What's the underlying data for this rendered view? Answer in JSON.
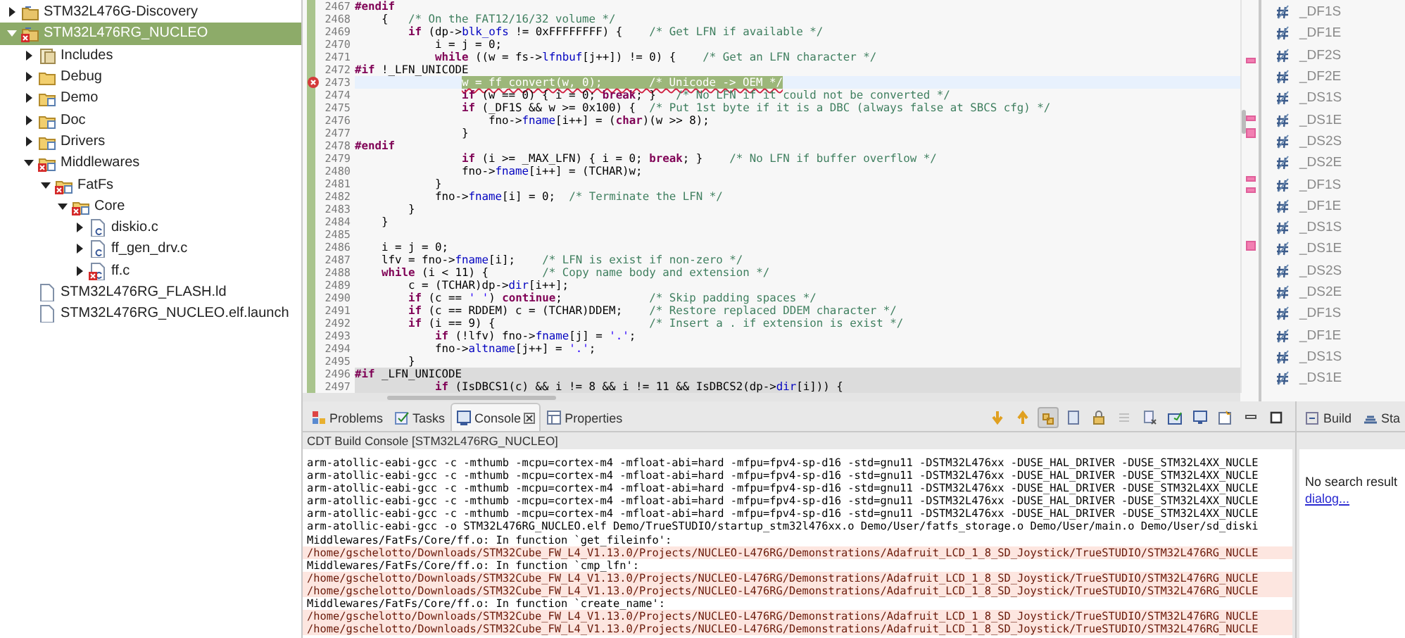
{
  "project_explorer": {
    "items": [
      {
        "label": "STM32L476G-Discovery",
        "kind": "project",
        "error": false,
        "selected": false,
        "expanded": false
      },
      {
        "label": "STM32L476RG_NUCLEO",
        "kind": "project",
        "error": true,
        "selected": true,
        "expanded": true,
        "children": [
          {
            "label": "Includes",
            "kind": "includes",
            "error": false,
            "selected": false,
            "expanded": false
          },
          {
            "label": "Debug",
            "kind": "folder",
            "error": false,
            "selected": false,
            "expanded": false
          },
          {
            "label": "Demo",
            "kind": "source",
            "error": false,
            "selected": false,
            "expanded": false
          },
          {
            "label": "Doc",
            "kind": "source",
            "error": false,
            "selected": false,
            "expanded": false
          },
          {
            "label": "Drivers",
            "kind": "source",
            "error": false,
            "selected": false,
            "expanded": false
          },
          {
            "label": "Middlewares",
            "kind": "source",
            "error": true,
            "selected": false,
            "expanded": true,
            "children": [
              {
                "label": "FatFs",
                "kind": "source",
                "error": true,
                "selected": false,
                "expanded": true,
                "children": [
                  {
                    "label": "Core",
                    "kind": "source",
                    "error": true,
                    "selected": false,
                    "expanded": true,
                    "children": [
                      {
                        "label": "diskio.c",
                        "kind": "csource",
                        "error": false,
                        "selected": false,
                        "expanded": false
                      },
                      {
                        "label": "ff_gen_drv.c",
                        "kind": "csource",
                        "error": false,
                        "selected": false,
                        "expanded": false
                      },
                      {
                        "label": "ff.c",
                        "kind": "csource",
                        "error": true,
                        "selected": false,
                        "expanded": false
                      }
                    ]
                  }
                ]
              }
            ]
          },
          {
            "label": "STM32L476RG_FLASH.ld",
            "kind": "file",
            "error": false,
            "selected": false
          },
          {
            "label": "STM32L476RG_NUCLEO.elf.launch",
            "kind": "file",
            "error": false,
            "selected": false
          }
        ]
      }
    ]
  },
  "editor": {
    "lines": [
      {
        "number": "2467",
        "current": false,
        "shaded": false,
        "error": false,
        "tokens": [
          {
            "kind": "pp",
            "text": "#endif"
          }
        ]
      },
      {
        "number": "2468",
        "current": false,
        "shaded": false,
        "error": false,
        "tokens": [
          {
            "kind": "code",
            "text": "    {   "
          },
          {
            "kind": "comment",
            "text": "/* On the FAT12/16/32 volume */"
          }
        ]
      },
      {
        "number": "2469",
        "current": false,
        "shaded": false,
        "error": false,
        "tokens": [
          {
            "kind": "kw",
            "text": "        if"
          },
          {
            "kind": "code",
            "text": " (dp->"
          },
          {
            "kind": "field",
            "text": "blk_ofs"
          },
          {
            "kind": "code",
            "text": " != 0xFFFFFFFF) {    "
          },
          {
            "kind": "comment",
            "text": "/* Get LFN if available */"
          }
        ]
      },
      {
        "number": "2470",
        "current": false,
        "shaded": false,
        "error": false,
        "tokens": [
          {
            "kind": "code",
            "text": "            i = j = 0;"
          }
        ]
      },
      {
        "number": "2471",
        "current": false,
        "shaded": false,
        "error": false,
        "tokens": [
          {
            "kind": "kw",
            "text": "            while"
          },
          {
            "kind": "code",
            "text": " ((w = fs->"
          },
          {
            "kind": "field",
            "text": "lfnbuf"
          },
          {
            "kind": "code",
            "text": "[j++]) != 0) {    "
          },
          {
            "kind": "comment",
            "text": "/* Get an LFN character */"
          }
        ]
      },
      {
        "number": "2472",
        "current": false,
        "shaded": false,
        "error": false,
        "tokens": [
          {
            "kind": "pp",
            "text": "#if"
          },
          {
            "kind": "code",
            "text": " !_LFN_UNICODE"
          }
        ]
      },
      {
        "number": "2473",
        "current": true,
        "shaded": false,
        "error": true,
        "tokens": [
          {
            "kind": "selection",
            "text": "                w = ff_convert(w, 0);       /* Unicode -> OEM */"
          }
        ]
      },
      {
        "number": "2474",
        "current": false,
        "shaded": false,
        "error": false,
        "tokens": [
          {
            "kind": "kw",
            "text": "                if"
          },
          {
            "kind": "code",
            "text": " (w == 0) { i = 0; "
          },
          {
            "kind": "kw",
            "text": "break"
          },
          {
            "kind": "code",
            "text": "; }   "
          },
          {
            "kind": "comment",
            "text": "/* No LFN if it could not be converted */"
          }
        ]
      },
      {
        "number": "2475",
        "current": false,
        "shaded": false,
        "error": false,
        "tokens": [
          {
            "kind": "kw",
            "text": "                if"
          },
          {
            "kind": "code",
            "text": " (_DF1S && w >= 0x100) {  "
          },
          {
            "kind": "comment",
            "text": "/* Put 1st byte if it is a DBC (always false at SBCS cfg) */"
          }
        ]
      },
      {
        "number": "2476",
        "current": false,
        "shaded": false,
        "error": false,
        "tokens": [
          {
            "kind": "code",
            "text": "                    fno->"
          },
          {
            "kind": "field",
            "text": "fname"
          },
          {
            "kind": "code",
            "text": "[i++] = ("
          },
          {
            "kind": "kw",
            "text": "char"
          },
          {
            "kind": "code",
            "text": ")(w >> 8);"
          }
        ]
      },
      {
        "number": "2477",
        "current": false,
        "shaded": false,
        "error": false,
        "tokens": [
          {
            "kind": "code",
            "text": "                }"
          }
        ]
      },
      {
        "number": "2478",
        "current": false,
        "shaded": false,
        "error": false,
        "tokens": [
          {
            "kind": "pp",
            "text": "#endif"
          }
        ]
      },
      {
        "number": "2479",
        "current": false,
        "shaded": false,
        "error": false,
        "tokens": [
          {
            "kind": "kw",
            "text": "                if"
          },
          {
            "kind": "code",
            "text": " (i >= _MAX_LFN) { i = 0; "
          },
          {
            "kind": "kw",
            "text": "break"
          },
          {
            "kind": "code",
            "text": "; }    "
          },
          {
            "kind": "comment",
            "text": "/* No LFN if buffer overflow */"
          }
        ]
      },
      {
        "number": "2480",
        "current": false,
        "shaded": false,
        "error": false,
        "tokens": [
          {
            "kind": "code",
            "text": "                fno->"
          },
          {
            "kind": "field",
            "text": "fname"
          },
          {
            "kind": "code",
            "text": "[i++] = (TCHAR)w;"
          }
        ]
      },
      {
        "number": "2481",
        "current": false,
        "shaded": false,
        "error": false,
        "tokens": [
          {
            "kind": "code",
            "text": "            }"
          }
        ]
      },
      {
        "number": "2482",
        "current": false,
        "shaded": false,
        "error": false,
        "tokens": [
          {
            "kind": "code",
            "text": "            fno->"
          },
          {
            "kind": "field",
            "text": "fname"
          },
          {
            "kind": "code",
            "text": "[i] = 0;  "
          },
          {
            "kind": "comment",
            "text": "/* Terminate the LFN */"
          }
        ]
      },
      {
        "number": "2483",
        "current": false,
        "shaded": false,
        "error": false,
        "tokens": [
          {
            "kind": "code",
            "text": "        }"
          }
        ]
      },
      {
        "number": "2484",
        "current": false,
        "shaded": false,
        "error": false,
        "tokens": [
          {
            "kind": "code",
            "text": "    }"
          }
        ]
      },
      {
        "number": "2485",
        "current": false,
        "shaded": false,
        "error": false
      },
      {
        "number": "2486",
        "current": false,
        "shaded": false,
        "error": false,
        "tokens": [
          {
            "kind": "code",
            "text": "    i = j = 0;"
          }
        ]
      },
      {
        "number": "2487",
        "current": false,
        "shaded": false,
        "error": false,
        "tokens": [
          {
            "kind": "code",
            "text": "    lfv = fno->"
          },
          {
            "kind": "field",
            "text": "fname"
          },
          {
            "kind": "code",
            "text": "[i];    "
          },
          {
            "kind": "comment",
            "text": "/* LFN is exist if non-zero */"
          }
        ]
      },
      {
        "number": "2488",
        "current": false,
        "shaded": false,
        "error": false,
        "tokens": [
          {
            "kind": "kw",
            "text": "    while"
          },
          {
            "kind": "code",
            "text": " (i < 11) {        "
          },
          {
            "kind": "comment",
            "text": "/* Copy name body and extension */"
          }
        ]
      },
      {
        "number": "2489",
        "current": false,
        "shaded": false,
        "error": false,
        "tokens": [
          {
            "kind": "code",
            "text": "        c = (TCHAR)dp->"
          },
          {
            "kind": "field",
            "text": "dir"
          },
          {
            "kind": "code",
            "text": "[i++];"
          }
        ]
      },
      {
        "number": "2490",
        "current": false,
        "shaded": false,
        "error": false,
        "tokens": [
          {
            "kind": "kw",
            "text": "        if"
          },
          {
            "kind": "code",
            "text": " (c == "
          },
          {
            "kind": "string",
            "text": "' '"
          },
          {
            "kind": "code",
            "text": ") "
          },
          {
            "kind": "kw",
            "text": "continue"
          },
          {
            "kind": "code",
            "text": ";             "
          },
          {
            "kind": "comment",
            "text": "/* Skip padding spaces */"
          }
        ]
      },
      {
        "number": "2491",
        "current": false,
        "shaded": false,
        "error": false,
        "tokens": [
          {
            "kind": "kw",
            "text": "        if"
          },
          {
            "kind": "code",
            "text": " (c == RDDEM) c = (TCHAR)DDEM;    "
          },
          {
            "kind": "comment",
            "text": "/* Restore replaced DDEM character */"
          }
        ]
      },
      {
        "number": "2492",
        "current": false,
        "shaded": false,
        "error": false,
        "tokens": [
          {
            "kind": "kw",
            "text": "        if"
          },
          {
            "kind": "code",
            "text": " (i == 9) {                       "
          },
          {
            "kind": "comment",
            "text": "/* Insert a . if extension is exist */"
          }
        ]
      },
      {
        "number": "2493",
        "current": false,
        "shaded": false,
        "error": false,
        "tokens": [
          {
            "kind": "kw",
            "text": "            if"
          },
          {
            "kind": "code",
            "text": " (!lfv) fno->"
          },
          {
            "kind": "field",
            "text": "fname"
          },
          {
            "kind": "code",
            "text": "[j] = "
          },
          {
            "kind": "string",
            "text": "'.'"
          },
          {
            "kind": "code",
            "text": ";"
          }
        ]
      },
      {
        "number": "2494",
        "current": false,
        "shaded": false,
        "error": false,
        "tokens": [
          {
            "kind": "code",
            "text": "            fno->"
          },
          {
            "kind": "field",
            "text": "altname"
          },
          {
            "kind": "code",
            "text": "[j++] = "
          },
          {
            "kind": "string",
            "text": "'.'"
          },
          {
            "kind": "code",
            "text": ";"
          }
        ]
      },
      {
        "number": "2495",
        "current": false,
        "shaded": false,
        "error": false,
        "tokens": [
          {
            "kind": "code",
            "text": "        }"
          }
        ]
      },
      {
        "number": "2496",
        "current": false,
        "shaded": true,
        "error": false,
        "tokens": [
          {
            "kind": "pp",
            "text": "#if"
          },
          {
            "kind": "code",
            "text": " _LFN_UNICODE"
          }
        ]
      },
      {
        "number": "2497",
        "current": false,
        "shaded": true,
        "error": false,
        "tokens": [
          {
            "kind": "kw",
            "text": "            if"
          },
          {
            "kind": "code",
            "text": " (IsDBCS1(c) && i != 8 && i != 11 && IsDBCS2(dp->"
          },
          {
            "kind": "field",
            "text": "dir"
          },
          {
            "kind": "code",
            "text": "[i])) {"
          }
        ]
      }
    ]
  },
  "outline": {
    "items": [
      "_DF1S",
      "_DF1E",
      "_DF2S",
      "_DF2E",
      "_DS1S",
      "_DS1E",
      "_DS2S",
      "_DS2E",
      "_DF1S",
      "_DF1E",
      "_DS1S",
      "_DS1E",
      "_DS2S",
      "_DS2E",
      "_DF1S",
      "_DF1E",
      "_DS1S",
      "_DS1E"
    ]
  },
  "bottom_panel": {
    "tabs": [
      {
        "label": "Problems",
        "kind": "problems",
        "selected": false,
        "closable": false
      },
      {
        "label": "Tasks",
        "kind": "tasks",
        "selected": false,
        "closable": false
      },
      {
        "label": "Console",
        "kind": "console",
        "selected": true,
        "closable": true
      },
      {
        "label": "Properties",
        "kind": "properties",
        "selected": false,
        "closable": false
      }
    ],
    "console_title": "CDT Build Console [STM32L476RG_NUCLEO]",
    "console_lines": [
      {
        "kind": "output",
        "text": "arm-atollic-eabi-gcc -c -mthumb -mcpu=cortex-m4 -mfloat-abi=hard -mfpu=fpv4-sp-d16 -std=gnu11 -DSTM32L476xx -DUSE_HAL_DRIVER -DUSE_STM32L4XX_NUCLE"
      },
      {
        "kind": "output",
        "text": "arm-atollic-eabi-gcc -c -mthumb -mcpu=cortex-m4 -mfloat-abi=hard -mfpu=fpv4-sp-d16 -std=gnu11 -DSTM32L476xx -DUSE_HAL_DRIVER -DUSE_STM32L4XX_NUCLE"
      },
      {
        "kind": "output",
        "text": "arm-atollic-eabi-gcc -c -mthumb -mcpu=cortex-m4 -mfloat-abi=hard -mfpu=fpv4-sp-d16 -std=gnu11 -DSTM32L476xx -DUSE_HAL_DRIVER -DUSE_STM32L4XX_NUCLE"
      },
      {
        "kind": "output",
        "text": "arm-atollic-eabi-gcc -c -mthumb -mcpu=cortex-m4 -mfloat-abi=hard -mfpu=fpv4-sp-d16 -std=gnu11 -DSTM32L476xx -DUSE_HAL_DRIVER -DUSE_STM32L4XX_NUCLE"
      },
      {
        "kind": "output",
        "text": "arm-atollic-eabi-gcc -c -mthumb -mcpu=cortex-m4 -mfloat-abi=hard -mfpu=fpv4-sp-d16 -std=gnu11 -DSTM32L476xx -DUSE_HAL_DRIVER -DUSE_STM32L4XX_NUCLE"
      },
      {
        "kind": "output",
        "text": "arm-atollic-eabi-gcc -o STM32L476RG_NUCLEO.elf Demo/TrueSTUDIO/startup_stm32l476xx.o Demo/User/fatfs_storage.o Demo/User/main.o Demo/User/sd_diski"
      },
      {
        "kind": "output",
        "text": "Middlewares/FatFs/Core/ff.o: In function `get_fileinfo':"
      },
      {
        "kind": "error",
        "text": "/home/gschelotto/Downloads/STM32Cube_FW_L4_V1.13.0/Projects/NUCLEO-L476RG/Demonstrations/Adafruit_LCD_1_8_SD_Joystick/TrueSTUDIO/STM32L476RG_NUCLE"
      },
      {
        "kind": "output",
        "text": "Middlewares/FatFs/Core/ff.o: In function `cmp_lfn':"
      },
      {
        "kind": "error",
        "text": "/home/gschelotto/Downloads/STM32Cube_FW_L4_V1.13.0/Projects/NUCLEO-L476RG/Demonstrations/Adafruit_LCD_1_8_SD_Joystick/TrueSTUDIO/STM32L476RG_NUCLE"
      },
      {
        "kind": "error",
        "text": "/home/gschelotto/Downloads/STM32Cube_FW_L4_V1.13.0/Projects/NUCLEO-L476RG/Demonstrations/Adafruit_LCD_1_8_SD_Joystick/TrueSTUDIO/STM32L476RG_NUCLE"
      },
      {
        "kind": "output",
        "text": "Middlewares/FatFs/Core/ff.o: In function `create_name':"
      },
      {
        "kind": "error",
        "text": "/home/gschelotto/Downloads/STM32Cube_FW_L4_V1.13.0/Projects/NUCLEO-L476RG/Demonstrations/Adafruit_LCD_1_8_SD_Joystick/TrueSTUDIO/STM32L476RG_NUCLE"
      },
      {
        "kind": "error",
        "text": "/home/gschelotto/Downloads/STM32Cube_FW_L4_V1.13.0/Projects/NUCLEO-L476RG/Demonstrations/Adafruit_LCD_1_8_SD_Joystick/TrueSTUDIO/STM32L476RG_NUCLE"
      }
    ]
  },
  "search_panel": {
    "tabs": [
      {
        "label": "Build",
        "kind": "build"
      },
      {
        "label": "Sta",
        "kind": "stack"
      }
    ],
    "message": "No search result",
    "link": "dialog..."
  }
}
